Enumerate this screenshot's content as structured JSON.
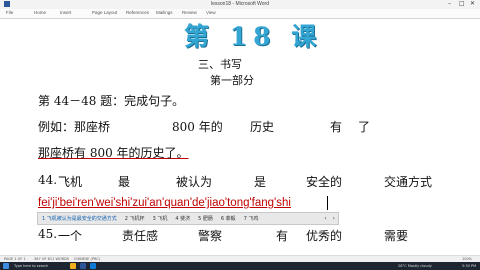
{
  "window": {
    "title": "lesson18 - Microsoft Word",
    "controls": {
      "minimize": "–",
      "maximize": "□",
      "close": "✕"
    }
  },
  "ribbon": {
    "tabs": [
      "File",
      "Home",
      "Insert",
      "Page Layout",
      "References",
      "Mailings",
      "Review",
      "View"
    ]
  },
  "document": {
    "heading": "第 18 课",
    "section": "三、书写",
    "part": "第一部分",
    "instruction": "第 44－48 题：完成句子。",
    "example": {
      "label": "例如：",
      "words": [
        "那座桥",
        "800 年的",
        "历史",
        "有",
        "了"
      ]
    },
    "answer": "那座桥有 800 年的历史了。",
    "q44": {
      "number": "44.",
      "words": [
        "飞机",
        "最",
        "被认为",
        "是",
        "安全的",
        "交通方式"
      ]
    },
    "q45": {
      "number": "45.",
      "words": [
        "一个",
        "责任感",
        "警察",
        "有",
        "优秀的",
        "需要"
      ]
    }
  },
  "ime": {
    "composition": "fei'ji'bei'ren'wei'shi'zui'an'quan'de'jiao'tong'fang'shi",
    "candidates": [
      "1 飞机被认为是最安全的交通方式",
      "2 飞机杯",
      "3 飞机",
      "4 斐济",
      "5 肥肠",
      "6 菲毅",
      "7 飞鸡"
    ],
    "prev_arrow": "‹",
    "next_arrow": "›"
  },
  "statusbar": {
    "page": "PAGE 1 OF 1",
    "words": "367 OF 611 WORDS",
    "language": "CHINESE (PRC)",
    "zoom": "100%"
  },
  "taskbar": {
    "search": "Type here to search",
    "weather": "28°C Mostly cloudy",
    "time": "5:30 PM"
  },
  "colors": {
    "heading": "#34a6d4",
    "ime_text": "#c00000",
    "answer_underline": "#c00000",
    "taskbar": "#1c2530"
  }
}
